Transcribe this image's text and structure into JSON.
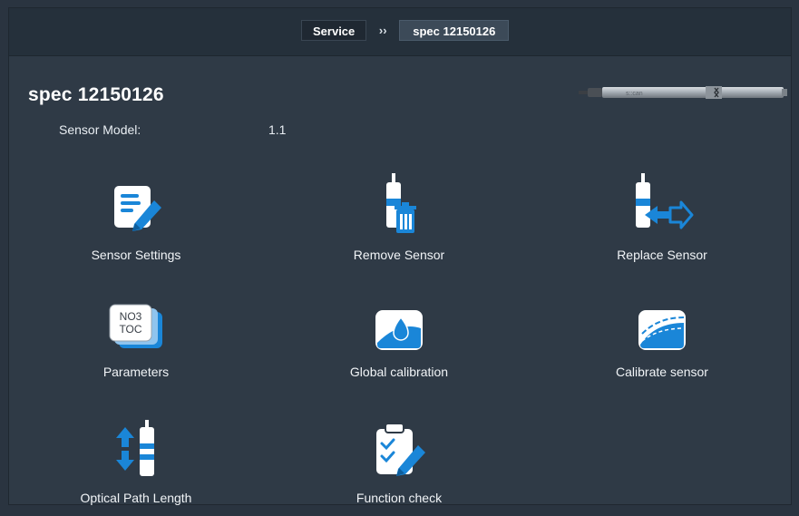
{
  "breadcrumb": {
    "items": [
      {
        "label": "Service"
      },
      {
        "label": "spec 12150126"
      }
    ],
    "separator": "››"
  },
  "header": {
    "title": "spec 12150126"
  },
  "details": {
    "sensor_model_label": "Sensor Model:",
    "sensor_model_value": "1.1"
  },
  "sensor_image": {
    "brand_text": "s::can"
  },
  "tiles": [
    {
      "label": "Sensor Settings",
      "icon": "sensor-settings-icon"
    },
    {
      "label": "Remove Sensor",
      "icon": "remove-sensor-icon"
    },
    {
      "label": "Replace Sensor",
      "icon": "replace-sensor-icon"
    },
    {
      "label": "Parameters",
      "icon": "parameters-icon",
      "icon_text_1": "NO3",
      "icon_text_2": "TOC"
    },
    {
      "label": "Global calibration",
      "icon": "global-calibration-icon"
    },
    {
      "label": "Calibrate sensor",
      "icon": "calibrate-sensor-icon"
    },
    {
      "label": "Optical Path Length",
      "icon": "optical-path-length-icon"
    },
    {
      "label": "Function check",
      "icon": "function-check-icon"
    }
  ],
  "colors": {
    "background": "#2f3a46",
    "topbar": "#25303b",
    "accent_blue": "#1a86d8",
    "icon_white": "#ffffff"
  }
}
